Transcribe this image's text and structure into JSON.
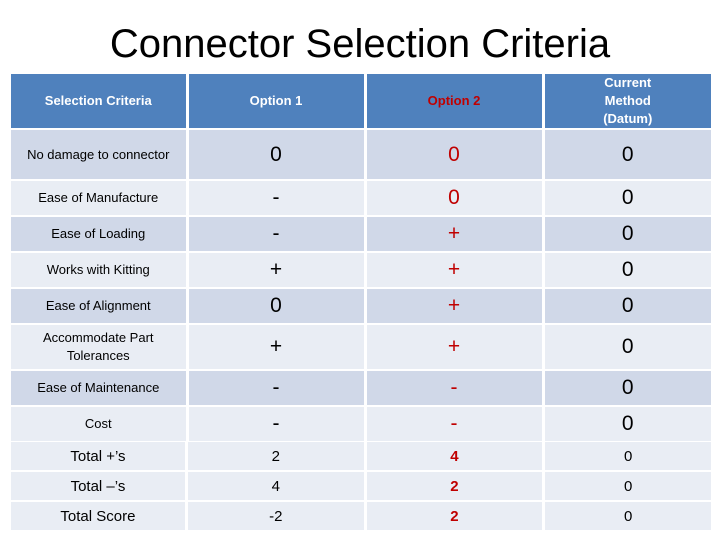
{
  "title": "Connector Selection Criteria",
  "colors": {
    "header_bg": "#4f81bd",
    "row_dark": "#d0d8e8",
    "row_light": "#e9edf4",
    "highlight": "#c00000"
  },
  "headers": [
    "Selection Criteria",
    "Option 1",
    "Option 2",
    "Current  Method (Datum)"
  ],
  "rows": [
    {
      "criteria": "No damage to connector",
      "option1": "0",
      "option2": "0",
      "datum": "0"
    },
    {
      "criteria": "Ease of Manufacture",
      "option1": "-",
      "option2": "0",
      "datum": "0"
    },
    {
      "criteria": "Ease of Loading",
      "option1": "-",
      "option2": "+",
      "datum": "0"
    },
    {
      "criteria": "Works with Kitting",
      "option1": "+",
      "option2": "+",
      "datum": "0"
    },
    {
      "criteria": "Ease of Alignment",
      "option1": "0",
      "option2": "+",
      "datum": "0"
    },
    {
      "criteria": "Accommodate Part Tolerances",
      "option1": "+",
      "option2": "+",
      "datum": "0"
    },
    {
      "criteria": "Ease of Maintenance",
      "option1": "-",
      "option2": "-",
      "datum": "0"
    },
    {
      "criteria": "Cost",
      "option1": "-",
      "option2": "-",
      "datum": "0"
    }
  ],
  "totals": [
    {
      "label": "Total +’s",
      "option1": "2",
      "option2": "4",
      "datum": "0"
    },
    {
      "label": "Total –’s",
      "option1": "4",
      "option2": "2",
      "datum": "0"
    },
    {
      "label": "Total Score",
      "option1": "-2",
      "option2": "2",
      "datum": "0"
    }
  ]
}
